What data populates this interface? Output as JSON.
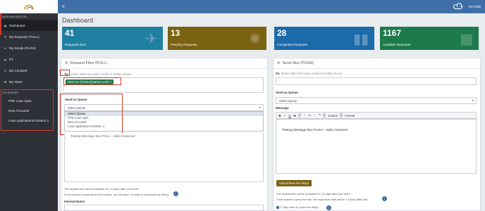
{
  "sidebar": {
    "nav_header": "MAIN NAVIGATION",
    "items": [
      {
        "label": "Dashboard",
        "icon": "dashboard-icon"
      },
      {
        "label": "My Requests (PULL)",
        "icon": "inbox-icon"
      },
      {
        "label": "My Sends (PUSH)",
        "icon": "send-icon"
      },
      {
        "label": "P2",
        "icon": "file-icon"
      },
      {
        "label": "My Contacts",
        "icon": "contacts-icon"
      },
      {
        "label": "My Team",
        "icon": "team-icon"
      }
    ],
    "queues_label": "MY QUEUES",
    "queues": [
      {
        "label": "PRE Loan Apps"
      },
      {
        "label": "New Accounts"
      },
      {
        "label": "Loan Applications Division 1"
      }
    ]
  },
  "topbar": {
    "menu": "≡",
    "user": "Tori Mills"
  },
  "page_title": "Dashboard",
  "stats": [
    {
      "value": "41",
      "label": "Requests Sent",
      "color": "#1f7fa0"
    },
    {
      "value": "13",
      "label": "Pending Requests",
      "color": "#7a6210"
    },
    {
      "value": "28",
      "label": "Completed Requests",
      "color": "#1d6aa8"
    },
    {
      "value": "1167",
      "label": "Available Requests",
      "color": "#1d7a4a"
    }
  ],
  "pull": {
    "title": "Request Files (PULL)",
    "to_label": "To:",
    "to_hint": "(Enter either the name, email or mobile phone)",
    "chip": "HSS Inc (hssinc@yahoo.com) ×",
    "queue_label": "Send as Queue",
    "queue_selected": "Select Queue",
    "queue_options": [
      "Select Queue",
      "PRE Loan Apps",
      "New Accounts",
      "Loan Applications Division 1"
    ],
    "message_partial": "Testing Message Box PULL - Hello Customer",
    "link_note": "The request link will be available for 14 days after you send.",
    "reply_note": "If the receiver responds to the request, you will have 14 days to download the file(s).",
    "internal_notes": "Internal Notes"
  },
  "push": {
    "title": "Send files (PUSH)",
    "to_label": "To:",
    "to_hint": "(Enter either the name, email or mobile phone)",
    "queue_label": "Send as Queue",
    "queue_selected": "Select Queue",
    "message_label": "Message",
    "toolbar": [
      "B",
      "I",
      "U",
      "S",
      "⁃",
      "≔",
      "⫶",
      "❝",
      "Source",
      "Format"
    ],
    "message": "Testing Message Box PUSH - Hello Customer",
    "select_btn": "Select/View the file(s)",
    "dl_note": "The download's will be available for 14 days after you send.",
    "expire_note": "If the receiver opens the link, the expiration date will be 14 days after that.",
    "two_step": "2 Step Auth to Open the file(s)"
  }
}
